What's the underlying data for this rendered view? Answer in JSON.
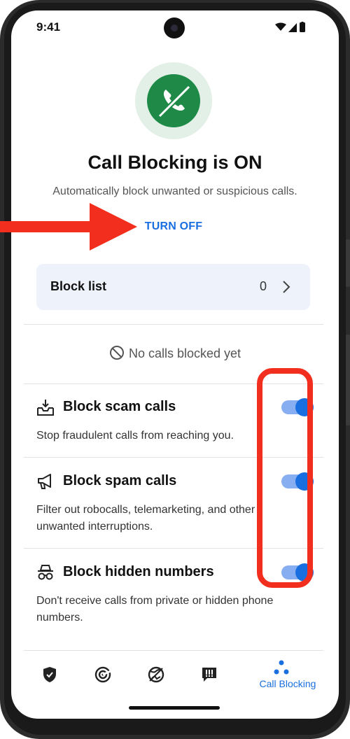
{
  "status_bar": {
    "time": "9:41"
  },
  "header": {
    "title": "Call Blocking is ON",
    "subtitle": "Automatically block unwanted or suspicious calls.",
    "turn_off_label": "TURN OFF"
  },
  "block_list": {
    "label": "Block list",
    "count": "0"
  },
  "empty_state": {
    "text": "No calls blocked yet"
  },
  "settings": [
    {
      "title": "Block scam calls",
      "description": "Stop fraudulent calls from reaching you.",
      "enabled": true,
      "icon": "scam-tray-icon"
    },
    {
      "title": "Block spam calls",
      "description": "Filter out robocalls, telemarketing, and other unwanted interruptions.",
      "enabled": true,
      "icon": "megaphone-icon"
    },
    {
      "title": "Block hidden numbers",
      "description": "Don't receive calls from private or hidden phone numbers.",
      "enabled": true,
      "icon": "incognito-icon"
    }
  ],
  "bottom_nav": [
    {
      "icon": "shield-check-icon",
      "label": ""
    },
    {
      "icon": "radar-icon",
      "label": ""
    },
    {
      "icon": "globe-slash-icon",
      "label": ""
    },
    {
      "icon": "alert-message-icon",
      "label": ""
    },
    {
      "icon": "call-blocking-icon",
      "label": "Call Blocking",
      "active": true
    }
  ],
  "colors": {
    "accent": "#1a6fe0",
    "hero_green": "#1f8a47",
    "hero_bg": "#e3f0e8",
    "annotation_red": "#f22f1e",
    "block_list_bg": "#eef3fb"
  }
}
